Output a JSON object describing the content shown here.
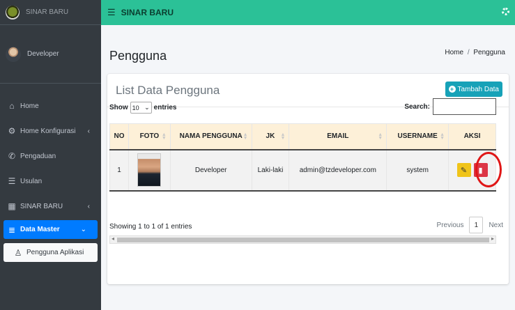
{
  "brand": {
    "name": "SINAR BARU",
    "logo_icon": "brand-logo-icon"
  },
  "user": {
    "name": "Developer"
  },
  "nav": [
    {
      "label": "Home",
      "icon": "home-icon",
      "glyph": "⌂",
      "arrow": ""
    },
    {
      "label": "Home Konfigurasi",
      "icon": "cogs-icon",
      "glyph": "⚙",
      "arrow": "‹"
    },
    {
      "label": "Pengaduan",
      "icon": "phone-icon",
      "glyph": "✆",
      "arrow": ""
    },
    {
      "label": "Usulan",
      "icon": "list-icon",
      "glyph": "☰",
      "arrow": ""
    },
    {
      "label": "SINAR BARU",
      "icon": "building-icon",
      "glyph": "▦",
      "arrow": "‹"
    },
    {
      "label": "Data Master",
      "icon": "database-icon",
      "glyph": "≣",
      "arrow": "⌄"
    }
  ],
  "subnav": {
    "label": "Pengguna Aplikasi",
    "icon": "user-outline-icon",
    "glyph": "♙"
  },
  "topbar": {
    "title": "SINAR BARU",
    "menu_glyph": "☰"
  },
  "page": {
    "title": "Pengguna"
  },
  "breadcrumb": {
    "home": "Home",
    "separator": "/",
    "current": "Pengguna"
  },
  "card": {
    "title": "List Data Pengguna",
    "add_label": "Tambah Data"
  },
  "table_controls": {
    "show_prefix": "Show",
    "show_value": "10",
    "show_suffix": "entries",
    "search_label": "Search:"
  },
  "table": {
    "columns": [
      "NO",
      "FOTO",
      "NAMA PENGGUNA",
      "JK",
      "EMAIL",
      "USERNAME",
      "AKSI"
    ],
    "rows": [
      {
        "no": "1",
        "nama": "Developer",
        "jk": "Laki-laki",
        "email": "admin@tzdeveloper.com",
        "username": "system"
      }
    ]
  },
  "footer": {
    "info": "Showing 1 to 1 of 1 entries",
    "previous": "Previous",
    "page": "1",
    "next": "Next"
  },
  "colors": {
    "topbar": "#2bc197",
    "sidebar": "#343a40",
    "active": "#007bff",
    "add_button": "#17a2b8",
    "edit": "#f0c419",
    "delete": "#dc3545",
    "highlight": "#e01616"
  }
}
